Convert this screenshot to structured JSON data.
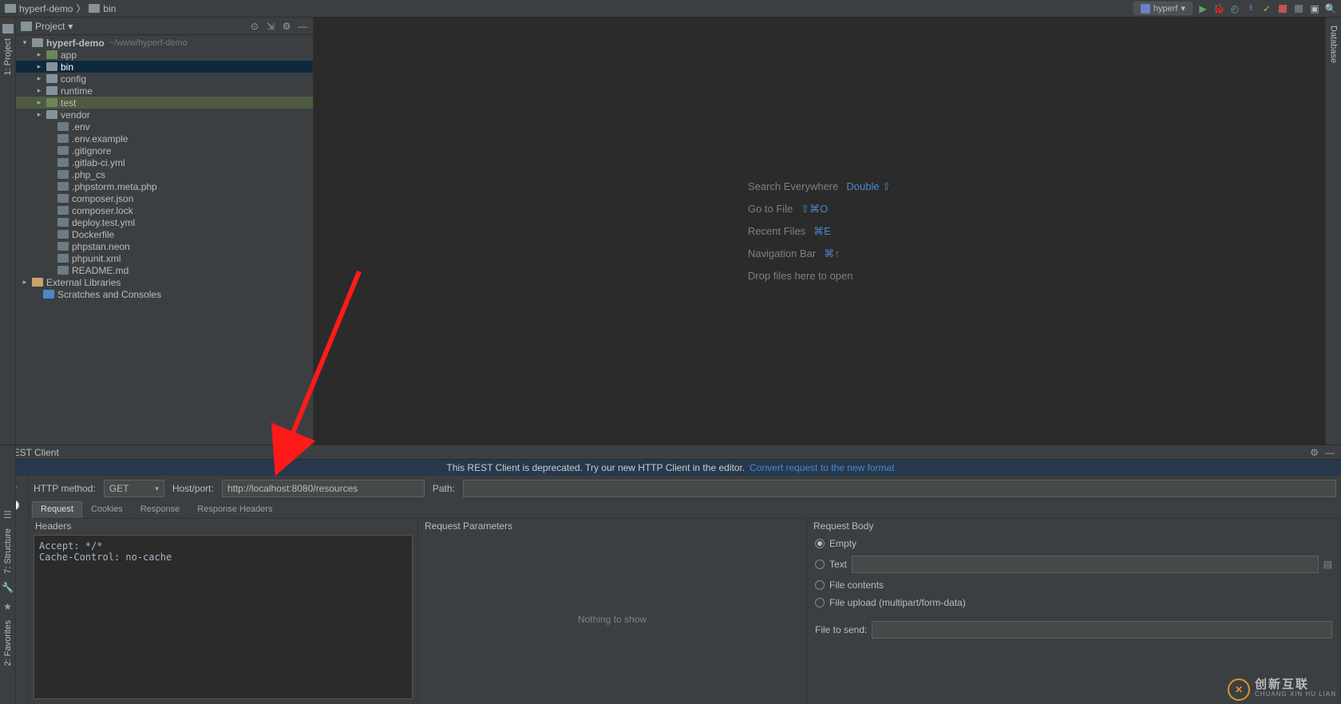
{
  "breadcrumb": {
    "root": "hyperf-demo",
    "child": "bin"
  },
  "runConfig": "hyperf",
  "projectPanel": {
    "title": "Project",
    "tree": {
      "root": {
        "name": "hyperf-demo",
        "path": "~/www/hyperf-demo"
      },
      "folders": [
        {
          "name": "app",
          "cls": "folder-src"
        },
        {
          "name": "bin",
          "cls": "folder-blue",
          "selected": true
        },
        {
          "name": "config",
          "cls": "folder-blue"
        },
        {
          "name": "runtime",
          "cls": "folder-blue"
        },
        {
          "name": "test",
          "cls": "folder-test",
          "highlight": true
        },
        {
          "name": "vendor",
          "cls": "folder-blue"
        }
      ],
      "files": [
        ".env",
        ".env.example",
        ".gitignore",
        ".gitlab-ci.yml",
        ".php_cs",
        ".phpstorm.meta.php",
        "composer.json",
        "composer.lock",
        "deploy.test.yml",
        "Dockerfile",
        "phpstan.neon",
        "phpunit.xml",
        "README.md"
      ],
      "ext1": "External Libraries",
      "ext2": "Scratches and Consoles"
    }
  },
  "welcome": {
    "r1a": "Search Everywhere",
    "r1b": "Double ⇧",
    "r2a": "Go to File",
    "r2b": "⇧⌘O",
    "r3a": "Recent Files",
    "r3b": "⌘E",
    "r4a": "Navigation Bar",
    "r4b": "⌘↑",
    "r5": "Drop files here to open"
  },
  "rest": {
    "title": "REST Client",
    "notice": "This REST Client is deprecated. Try our new HTTP Client in the editor.",
    "noticeLink": "Convert request to the new format",
    "httpMethodLabel": "HTTP method:",
    "httpMethod": "GET",
    "hostLabel": "Host/port:",
    "host": "http://localhost:8080/resources",
    "pathLabel": "Path:",
    "tabs": [
      "Request",
      "Cookies",
      "Response",
      "Response Headers"
    ],
    "colHeaders": "Headers",
    "headersText": "Accept: */*\nCache-Control: no-cache",
    "colParams": "Request Parameters",
    "paramsEmpty": "Nothing to show",
    "colBody": "Request Body",
    "bodyEmpty": "Empty",
    "bodyText": "Text",
    "bodyFileContents": "File contents",
    "bodyFileUpload": "File upload (multipart/form-data)",
    "bodyFileToSend": "File to send:"
  },
  "leftStrip": {
    "project": "1: Project"
  },
  "leftBottom": {
    "structure": "7: Structure",
    "favorites": "2: Favorites"
  },
  "rightStrip": {
    "database": "Database"
  },
  "watermark": {
    "big": "创新互联",
    "small": "CHUANG XIN HU LIAN"
  }
}
